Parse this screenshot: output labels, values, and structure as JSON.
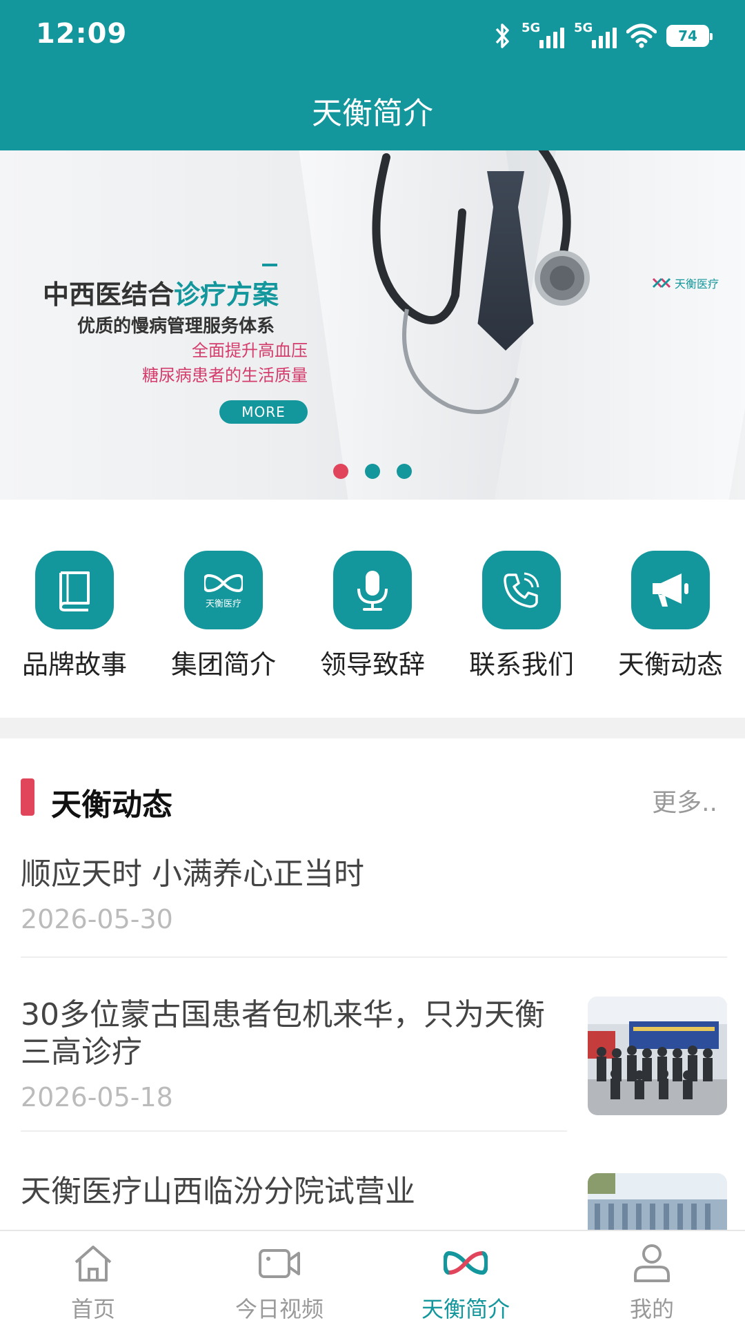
{
  "status_bar": {
    "time": "12:09",
    "network1": "5G",
    "network2": "5G",
    "battery": "74"
  },
  "header": {
    "title": "天衡简介"
  },
  "banner": {
    "heading_prefix": "中西医结合",
    "heading_highlight": "诊疗方案",
    "subheading": "优质的慢病管理服务体系",
    "line1": "全面提升高血压",
    "line2": "糖尿病患者的生活质量",
    "more_button": "MORE",
    "logo_text": "天衡医疗",
    "slide_count": 3,
    "active_slide": 0
  },
  "quick_menu": [
    {
      "label": "品牌故事",
      "icon": "book-icon"
    },
    {
      "label": "集团简介",
      "icon": "tianheng-logo-icon"
    },
    {
      "label": "领导致辞",
      "icon": "microphone-icon"
    },
    {
      "label": "联系我们",
      "icon": "phone-icon"
    },
    {
      "label": "天衡动态",
      "icon": "megaphone-icon"
    }
  ],
  "quick_logo_text": "天衡医疗",
  "news_section": {
    "title": "天衡动态",
    "more": "更多.."
  },
  "news": [
    {
      "title": "顺应天时 小满养心正当时",
      "date": "2026-05-30"
    },
    {
      "title": "30多位蒙古国患者包机来华，只为天衡三高诊疗",
      "date": "2026-05-18"
    },
    {
      "title": "天衡医疗山西临汾分院试营业",
      "date": ""
    }
  ],
  "tabbar": [
    {
      "label": "首页",
      "icon": "home-icon",
      "active": false
    },
    {
      "label": "今日视频",
      "icon": "video-camera-icon",
      "active": false
    },
    {
      "label": "天衡简介",
      "icon": "tianheng-logo-icon",
      "active": true
    },
    {
      "label": "我的",
      "icon": "user-icon",
      "active": false
    }
  ],
  "colors": {
    "primary": "#13979c",
    "accent": "#e0455c"
  }
}
